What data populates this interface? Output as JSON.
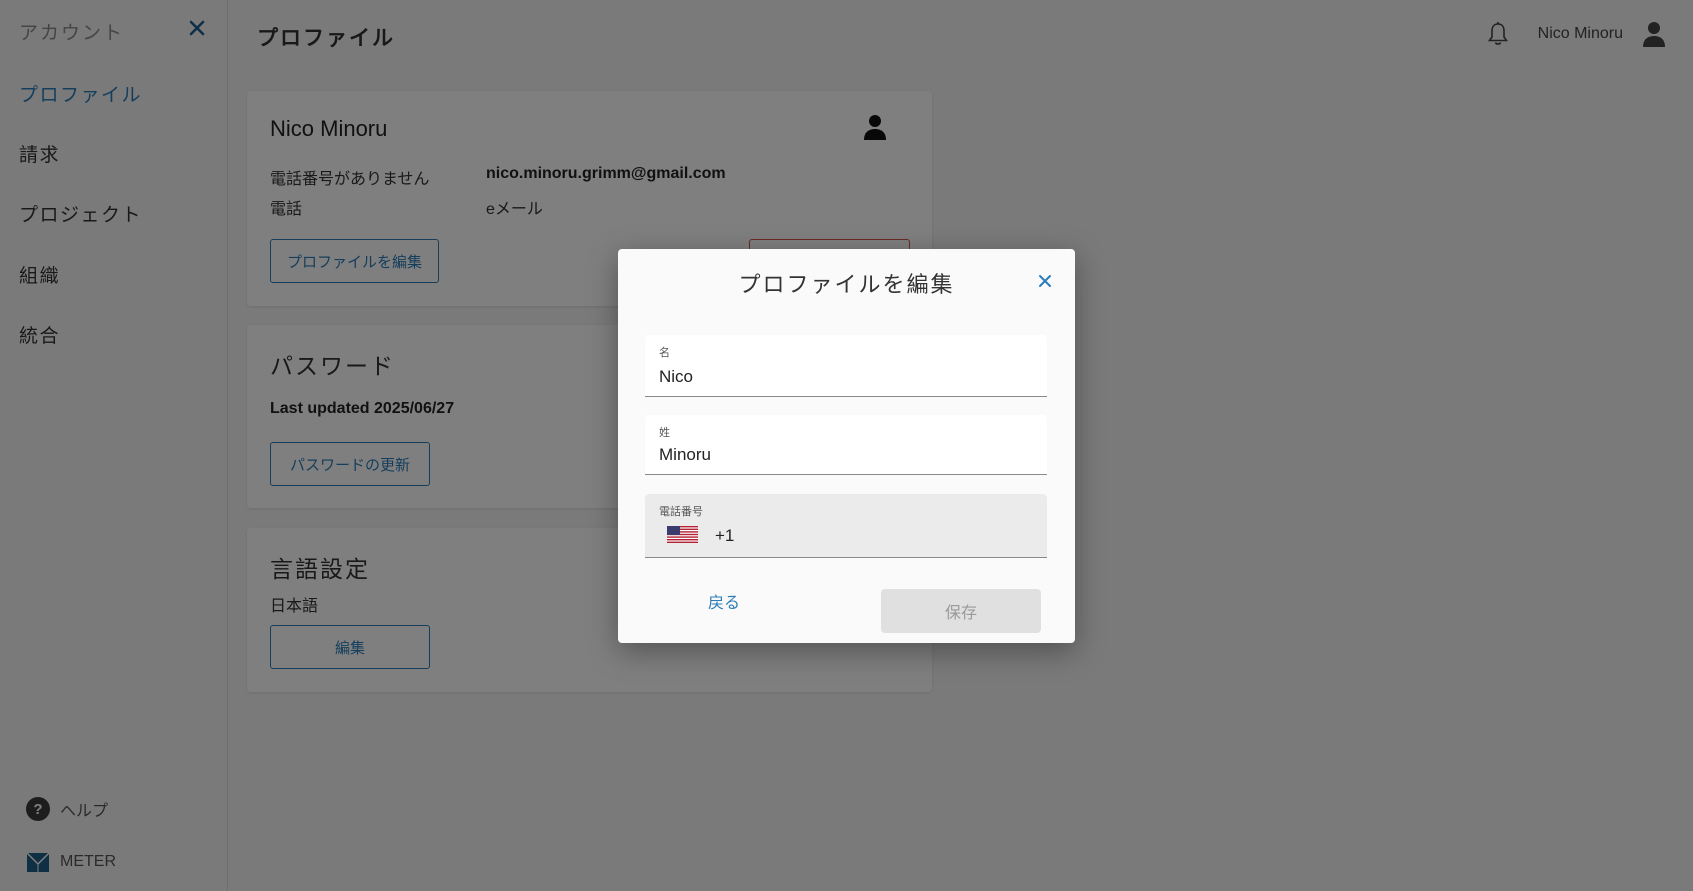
{
  "sidebar": {
    "title": "アカウント",
    "items": [
      {
        "label": "プロファイル",
        "active": true
      },
      {
        "label": "請求"
      },
      {
        "label": "プロジェクト"
      },
      {
        "label": "組織"
      },
      {
        "label": "統合"
      }
    ],
    "help_label": "ヘルプ",
    "brand_label": "METER"
  },
  "header": {
    "title": "プロファイル",
    "user_name": "Nico Minoru"
  },
  "profile_card": {
    "name": "Nico Minoru",
    "phone_value": "電話番号がありません",
    "phone_label": "電話",
    "email_value": "nico.minoru.grimm@gmail.com",
    "email_label": "eメール",
    "edit_button": "プロファイルを編集"
  },
  "password_card": {
    "heading": "パスワード",
    "last_updated": "Last updated 2025/06/27",
    "update_button": "パスワードの更新"
  },
  "language_card": {
    "heading": "言語設定",
    "current": "日本語",
    "edit_button": "編集"
  },
  "modal": {
    "title": "プロファイルを編集",
    "first_name": {
      "label": "名",
      "value": "Nico"
    },
    "last_name": {
      "label": "姓",
      "value": "Minoru"
    },
    "phone": {
      "label": "電話番号",
      "country_code": "+1",
      "flag": "us-flag-icon"
    },
    "back_button": "戻る",
    "save_button": "保存"
  },
  "colors": {
    "accent": "#2a7db8",
    "overlay": "rgba(0,0,0,0.5)"
  }
}
